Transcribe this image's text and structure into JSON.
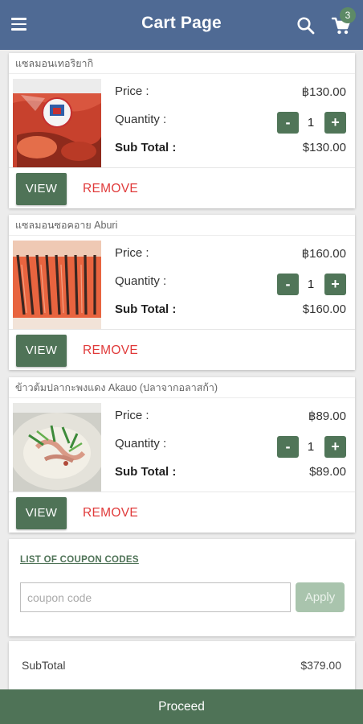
{
  "header": {
    "title": "Cart Page",
    "cart_count": "3",
    "icons": [
      "menu-icon",
      "search-icon",
      "cart-icon"
    ]
  },
  "labels": {
    "price": "Price :",
    "quantity": "Quantity :",
    "subtotal": "Sub Total :",
    "view": "VIEW",
    "remove": "REMOVE",
    "minus": "-",
    "plus": "+"
  },
  "cart_items": [
    {
      "name": "แซลมอนเทอริยากิ",
      "price": "฿130.00",
      "quantity": "1",
      "subtotal": "$130.00",
      "image_watermark": ""
    },
    {
      "name": "แซลมอนซอคอาย Aburi",
      "price": "฿160.00",
      "quantity": "1",
      "subtotal": "$160.00",
      "image_watermark": ""
    },
    {
      "name": "ข้าวต้มปลากะพงแดง Akauo (ปลาจากอลาสก้า)",
      "price": "฿89.00",
      "quantity": "1",
      "subtotal": "$89.00",
      "image_watermark": ""
    }
  ],
  "coupon": {
    "list_label": "LIST OF COUPON CODES",
    "placeholder": "coupon code",
    "value": "",
    "apply_label": "Apply"
  },
  "summary": {
    "subtotal_label": "SubTotal",
    "subtotal_value": "$379.00"
  },
  "footer": {
    "proceed_label": "Proceed"
  },
  "colors": {
    "appbar": "#4f6a94",
    "primary_green": "#4f7357",
    "remove_red": "#e03a3a",
    "apply_disabled": "#a9c4ad",
    "badge": "#5d8a66"
  }
}
